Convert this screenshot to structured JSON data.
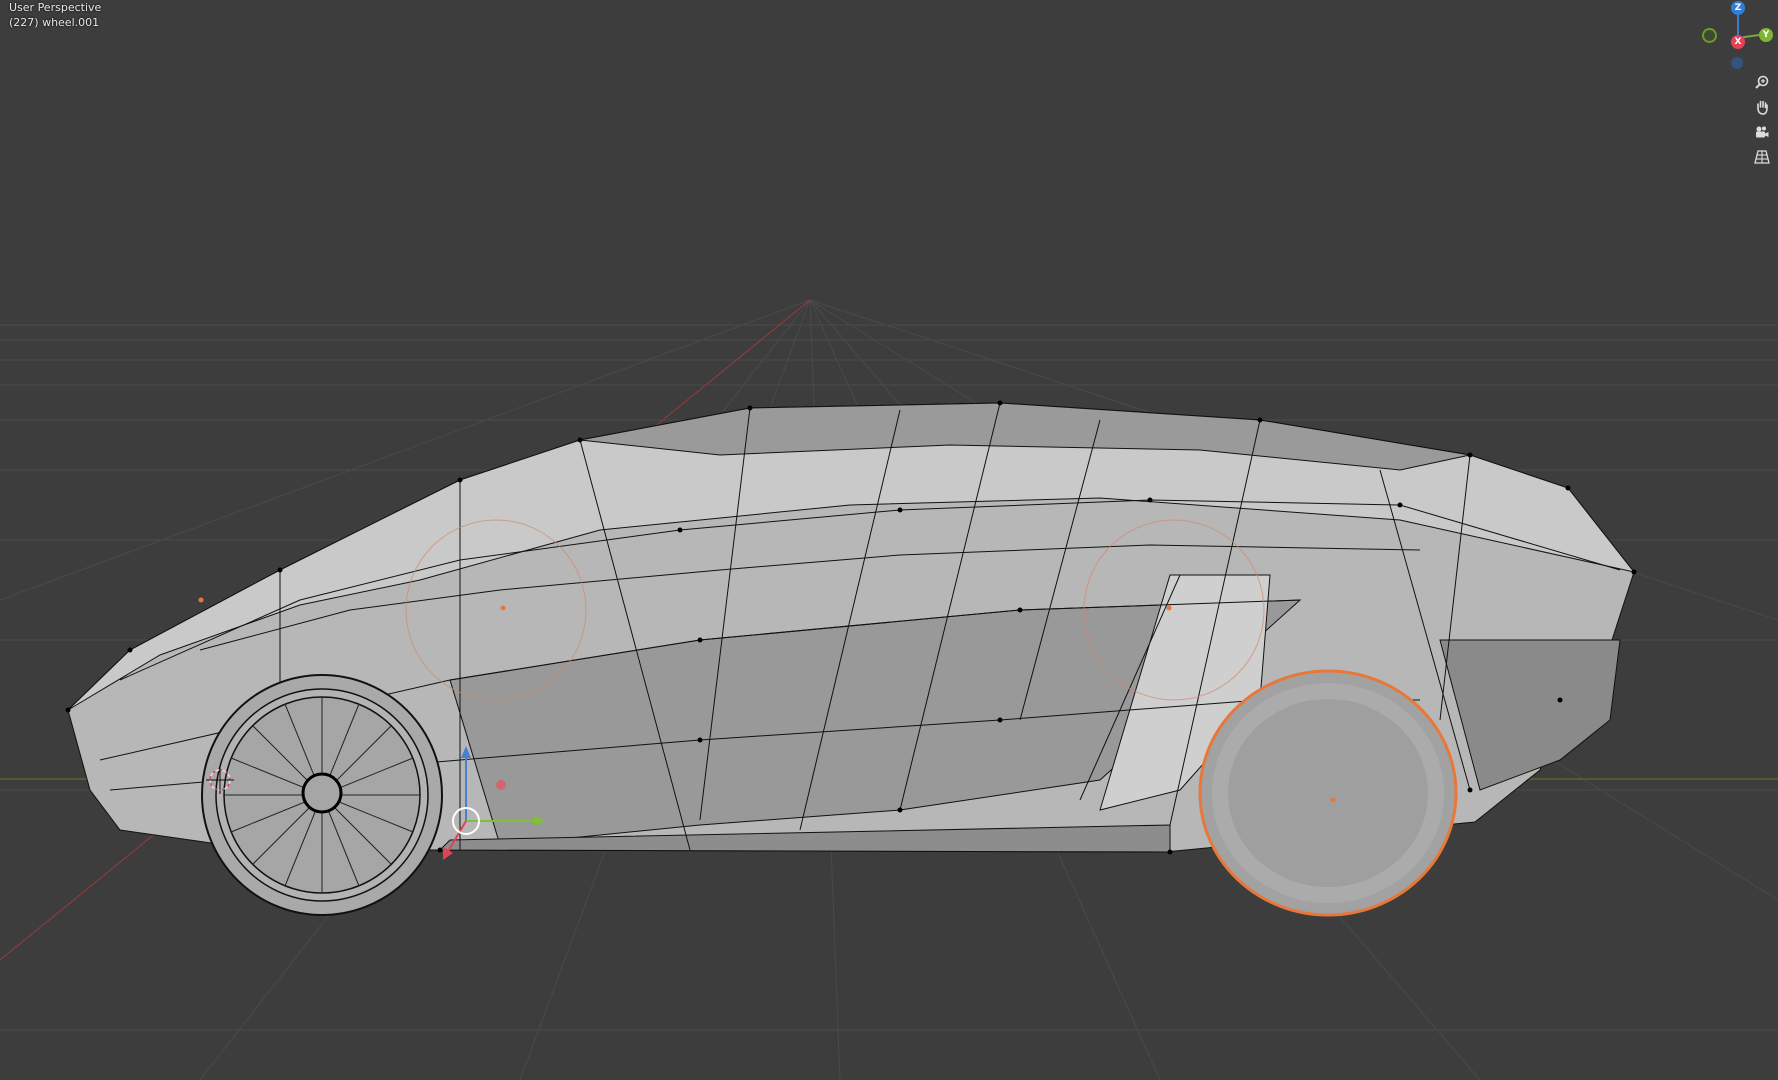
{
  "viewport": {
    "view_name": "User Perspective",
    "object_info": "(227) wheel.001",
    "background_color": "#3d3d3d",
    "selection_color": "#e8773a"
  },
  "gizmo": {
    "z_label": "Z",
    "x_label": "X",
    "y_label": "Y",
    "colors": {
      "x": "#e34256",
      "y": "#7fb533",
      "z": "#2f7fd8"
    }
  },
  "nav_controls": [
    {
      "name": "zoom-icon"
    },
    {
      "name": "hand-pan-icon"
    },
    {
      "name": "camera-icon"
    },
    {
      "name": "grid-perspective-icon"
    }
  ]
}
